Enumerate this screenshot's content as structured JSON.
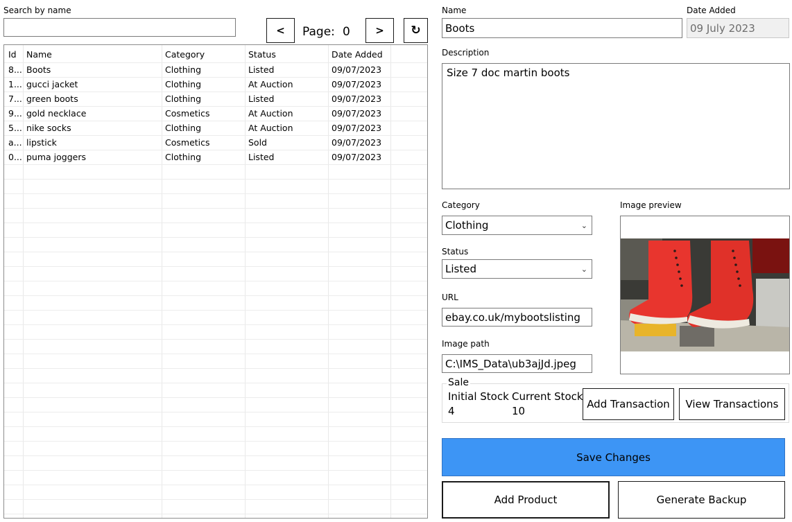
{
  "search": {
    "label": "Search by name",
    "value": ""
  },
  "pager": {
    "prev": "<",
    "next": ">",
    "page_label": "Page:",
    "page_value": "0",
    "refresh_icon": "refresh-icon",
    "refresh_glyph": "↻"
  },
  "grid": {
    "headers": [
      "Id",
      "Name",
      "Category",
      "Status",
      "Date Added"
    ],
    "rows": [
      [
        "8...",
        "Boots",
        "Clothing",
        "Listed",
        "09/07/2023"
      ],
      [
        "1...",
        "gucci jacket",
        "Clothing",
        "At Auction",
        "09/07/2023"
      ],
      [
        "7...",
        "green boots",
        "Clothing",
        "Listed",
        "09/07/2023"
      ],
      [
        "9...",
        "gold necklace",
        "Cosmetics",
        "At Auction",
        "09/07/2023"
      ],
      [
        "5...",
        "nike socks",
        "Clothing",
        "At Auction",
        "09/07/2023"
      ],
      [
        "a...",
        "lipstick",
        "Cosmetics",
        "Sold",
        "09/07/2023"
      ],
      [
        "0...",
        "puma joggers",
        "Clothing",
        "Listed",
        "09/07/2023"
      ]
    ]
  },
  "detail": {
    "name_label": "Name",
    "name_value": "Boots",
    "date_label": "Date Added",
    "date_value": "09 July 2023",
    "description_label": "Description",
    "description_value": "Size 7 doc martin boots",
    "category_label": "Category",
    "category_value": "Clothing",
    "status_label": "Status",
    "status_value": "Listed",
    "url_label": "URL",
    "url_value": "ebay.co.uk/mybootslisting",
    "image_path_label": "Image path",
    "image_path_value": "C:\\IMS_Data\\ub3ajJd.jpeg",
    "image_preview_label": "Image preview"
  },
  "sale": {
    "title": "Sale",
    "initial_stock_label": "Initial Stock",
    "initial_stock_value": "4",
    "current_stock_label": "Current Stock",
    "current_stock_value": "10",
    "add_transaction": "Add Transaction",
    "view_transactions": "View Transactions"
  },
  "actions": {
    "save": "Save Changes",
    "add_product": "Add Product",
    "generate_backup": "Generate Backup"
  },
  "colors": {
    "accent": "#3d95f5",
    "disabled_bg": "#f0f0f0",
    "disabled_text": "#6d6d6d",
    "boot_red": "#e8352e"
  }
}
